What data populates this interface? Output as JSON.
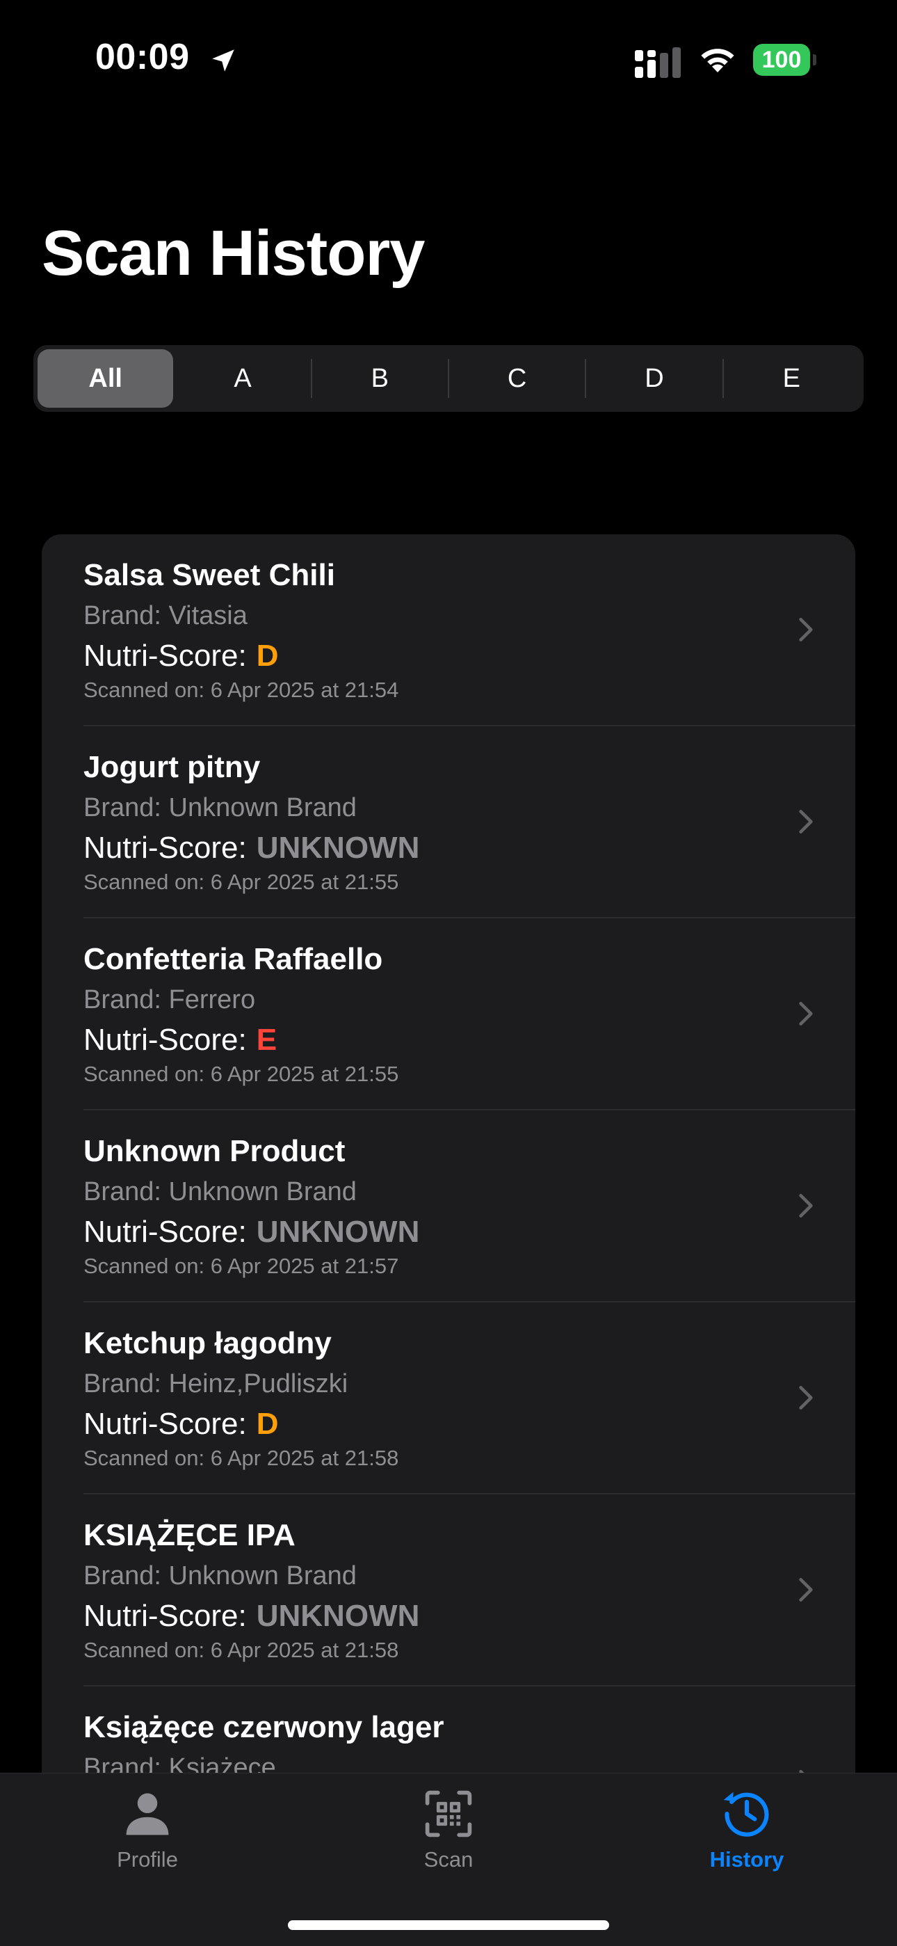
{
  "status_bar": {
    "time": "00:09",
    "battery": "100"
  },
  "page": {
    "title": "Scan History"
  },
  "filter": {
    "segments": [
      "All",
      "A",
      "B",
      "C",
      "D",
      "E"
    ],
    "selected": "All"
  },
  "labels": {
    "brand_prefix": "Brand: ",
    "nutri_score": "Nutri-Score:",
    "scanned_prefix": "Scanned on: "
  },
  "history": [
    {
      "name": "Salsa Sweet Chili",
      "brand": "Brand: Vitasia",
      "score": "D",
      "score_color": "#ff9f0a",
      "scanned": "Scanned on: 6 Apr 2025 at 21:54"
    },
    {
      "name": "Jogurt pitny",
      "brand": "Brand: Unknown Brand",
      "score": "UNKNOWN",
      "score_color": "#8e8e93",
      "scanned": "Scanned on: 6 Apr 2025 at 21:55"
    },
    {
      "name": "Confetteria Raffaello",
      "brand": "Brand: Ferrero",
      "score": "E",
      "score_color": "#ff453a",
      "scanned": "Scanned on: 6 Apr 2025 at 21:55"
    },
    {
      "name": "Unknown Product",
      "brand": "Brand: Unknown Brand",
      "score": "UNKNOWN",
      "score_color": "#8e8e93",
      "scanned": "Scanned on: 6 Apr 2025 at 21:57"
    },
    {
      "name": "Ketchup łagodny",
      "brand": "Brand: Heinz,Pudliszki",
      "score": "D",
      "score_color": "#ff9f0a",
      "scanned": "Scanned on: 6 Apr 2025 at 21:58"
    },
    {
      "name": "KSIĄŻĘCE IPA",
      "brand": "Brand: Unknown Brand",
      "score": "UNKNOWN",
      "score_color": "#8e8e93",
      "scanned": "Scanned on: 6 Apr 2025 at 21:58"
    },
    {
      "name": "Książęce czerwony lager",
      "brand": "Brand: Książęce",
      "score": "",
      "score_color": "#8e8e93",
      "scanned": ""
    }
  ],
  "tab_bar": {
    "tabs": [
      {
        "label": "Profile",
        "icon": "person-icon",
        "active": false
      },
      {
        "label": "Scan",
        "icon": "qr-scan-icon",
        "active": false
      },
      {
        "label": "History",
        "icon": "history-clock-icon",
        "active": true
      }
    ],
    "active_color": "#0a84ff",
    "inactive_color": "#8e8e93"
  }
}
